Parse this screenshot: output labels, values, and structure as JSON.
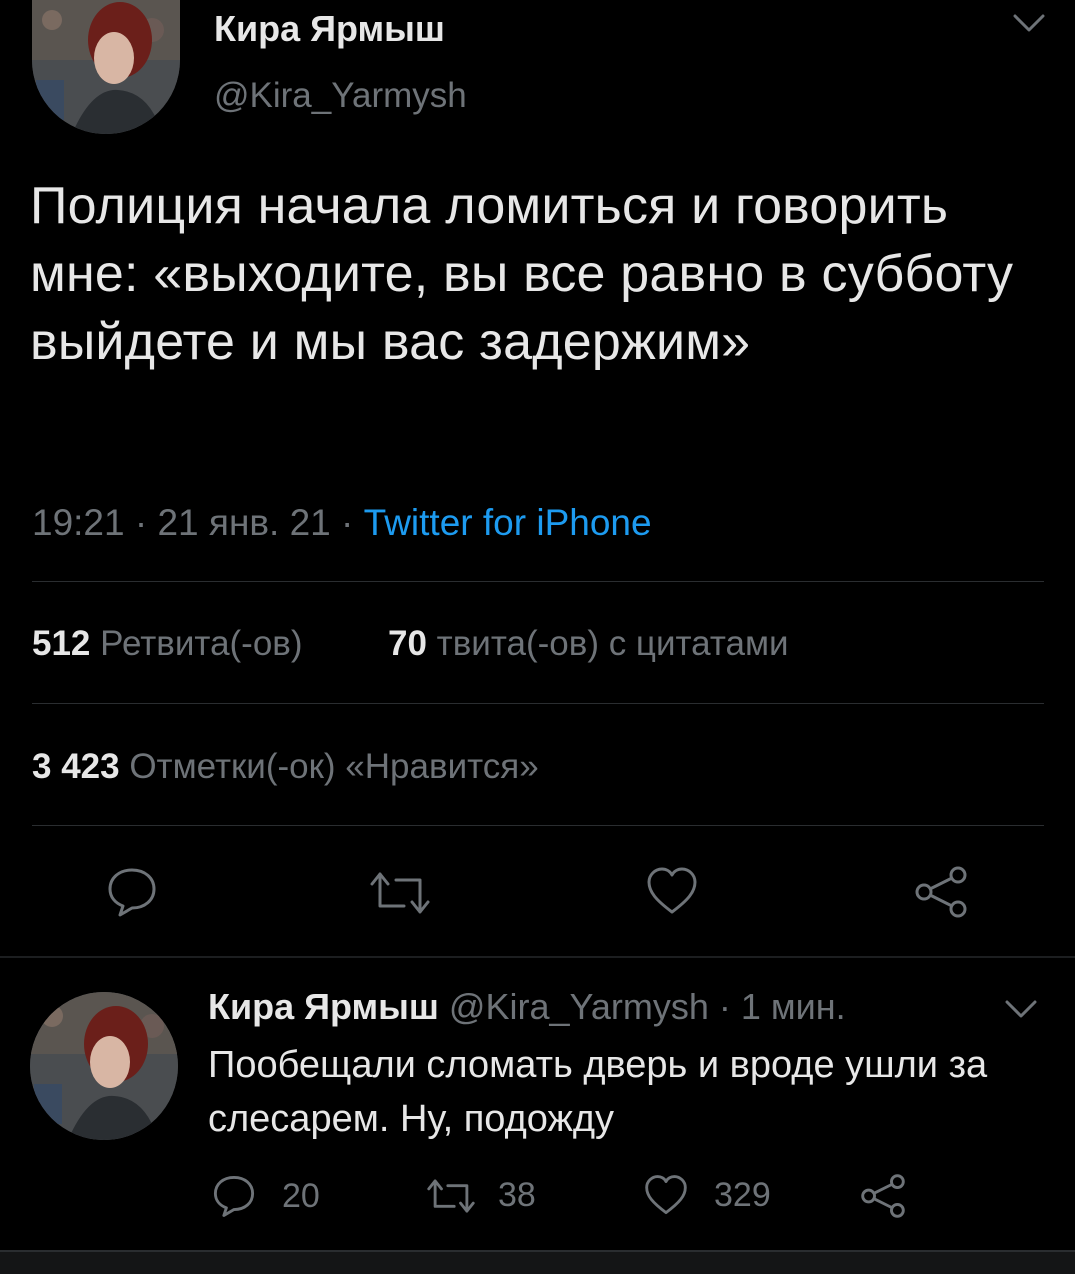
{
  "tweet": {
    "author_name": "Кира Ярмыш",
    "author_handle": "@Kira_Yarmysh",
    "text": "Полиция начала ломиться и говорить мне: «выходите, вы все равно в субботу выйдете и мы вас задержим»",
    "time": "19:21",
    "date": "21 янв. 21",
    "source": "Twitter for iPhone",
    "sep": " · ",
    "retweets_count": "512",
    "retweets_label": "Ретвита(-ов)",
    "quotes_count": "70",
    "quotes_label": "твита(-ов) с цитатами",
    "likes_count": "3 423",
    "likes_label": "Отметки(-ок) «Нравится»"
  },
  "reply": {
    "author_name": "Кира Ярмыш",
    "author_handle": "@Kira_Yarmysh",
    "time_ago": "· 1 мин.",
    "text": "Пообещали сломать дверь и вроде ушли за слесарем. Ну, подожду",
    "reply_count": "20",
    "retweet_count": "38",
    "like_count": "329"
  },
  "icons": {
    "reply": "comment-icon",
    "retweet": "retweet-icon",
    "like": "heart-icon",
    "share": "share-icon",
    "menu": "chevron-down-icon"
  },
  "colors": {
    "background": "#000000",
    "text": "#e7e7e7",
    "muted": "#6e7378",
    "link": "#1d9bf0"
  }
}
